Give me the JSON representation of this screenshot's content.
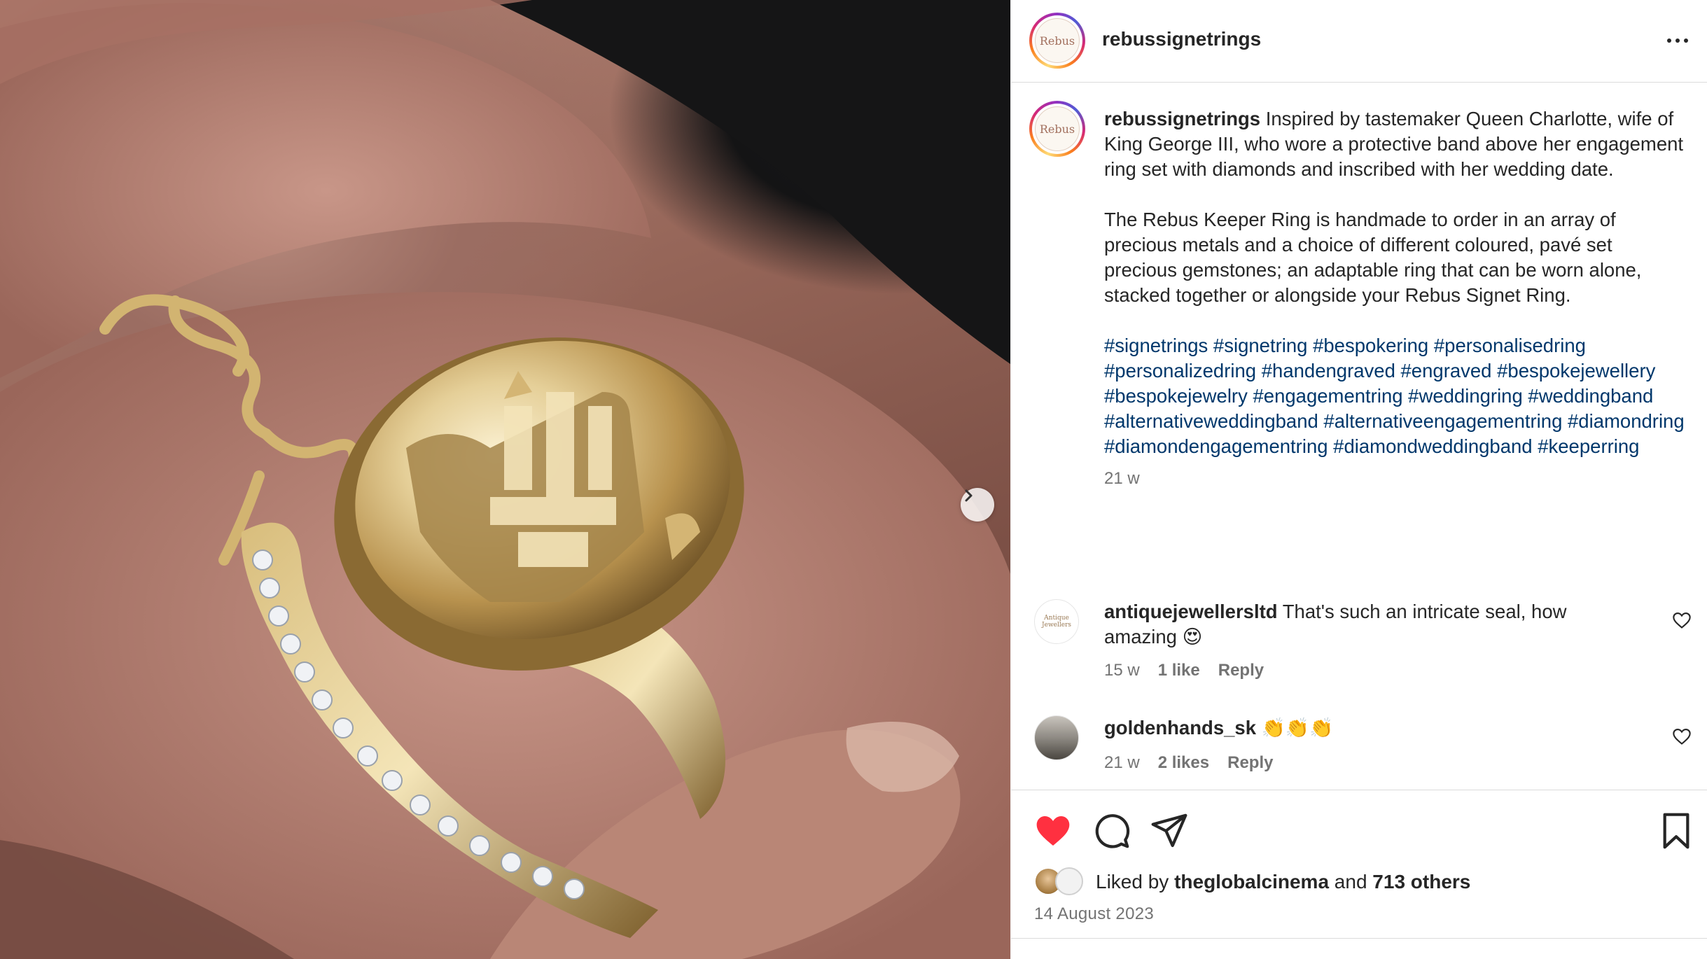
{
  "post": {
    "username": "rebussignetrings",
    "avatar_text": "Rebus",
    "caption_username": "rebussignetrings",
    "caption_p1": "Inspired by tastemaker Queen Charlotte, wife of King George III, who wore a protective band above her engagement ring set with diamonds and inscribed with her wedding date.",
    "caption_p2": "The Rebus Keeper Ring is handmade to order in an array of precious metals and a choice of different coloured, pavé set precious gemstones; an adaptable ring that can be worn alone, stacked together or alongside your Rebus Signet Ring.",
    "hashtags": "#signetrings #signetring #bespokering #personalisedring #personalizedring #handengraved #engraved #bespokejewellery #bespokejewelry #engagementring #weddingring #weddingband #alternativeweddingband #alternativeengagementring #diamondring #diamondengagementring #diamondweddingband #keeperring",
    "caption_time": "21 w"
  },
  "comments": [
    {
      "username": "antiquejewellersltd",
      "text": "That's such an intricate seal, how amazing 😍",
      "time": "15 w",
      "likes": "1 like",
      "reply": "Reply",
      "avatar_text": "Antique Jewellers"
    },
    {
      "username": "goldenhands_sk",
      "text": "👏👏👏",
      "time": "21 w",
      "likes": "2 likes",
      "reply": "Reply"
    }
  ],
  "likes": {
    "prefix": "Liked by",
    "by_user": "theglobalcinema",
    "and": "and",
    "others": "713 others"
  },
  "date": "14 August 2023",
  "icons": {
    "heart": "heart-filled-icon",
    "comment": "comment-icon",
    "share": "share-icon",
    "save": "bookmark-icon",
    "next": "chevron-right-icon",
    "more": "more-horizontal-icon"
  },
  "colors": {
    "heart": "#ff3040",
    "hashtag": "#00376b",
    "muted": "#737373"
  }
}
